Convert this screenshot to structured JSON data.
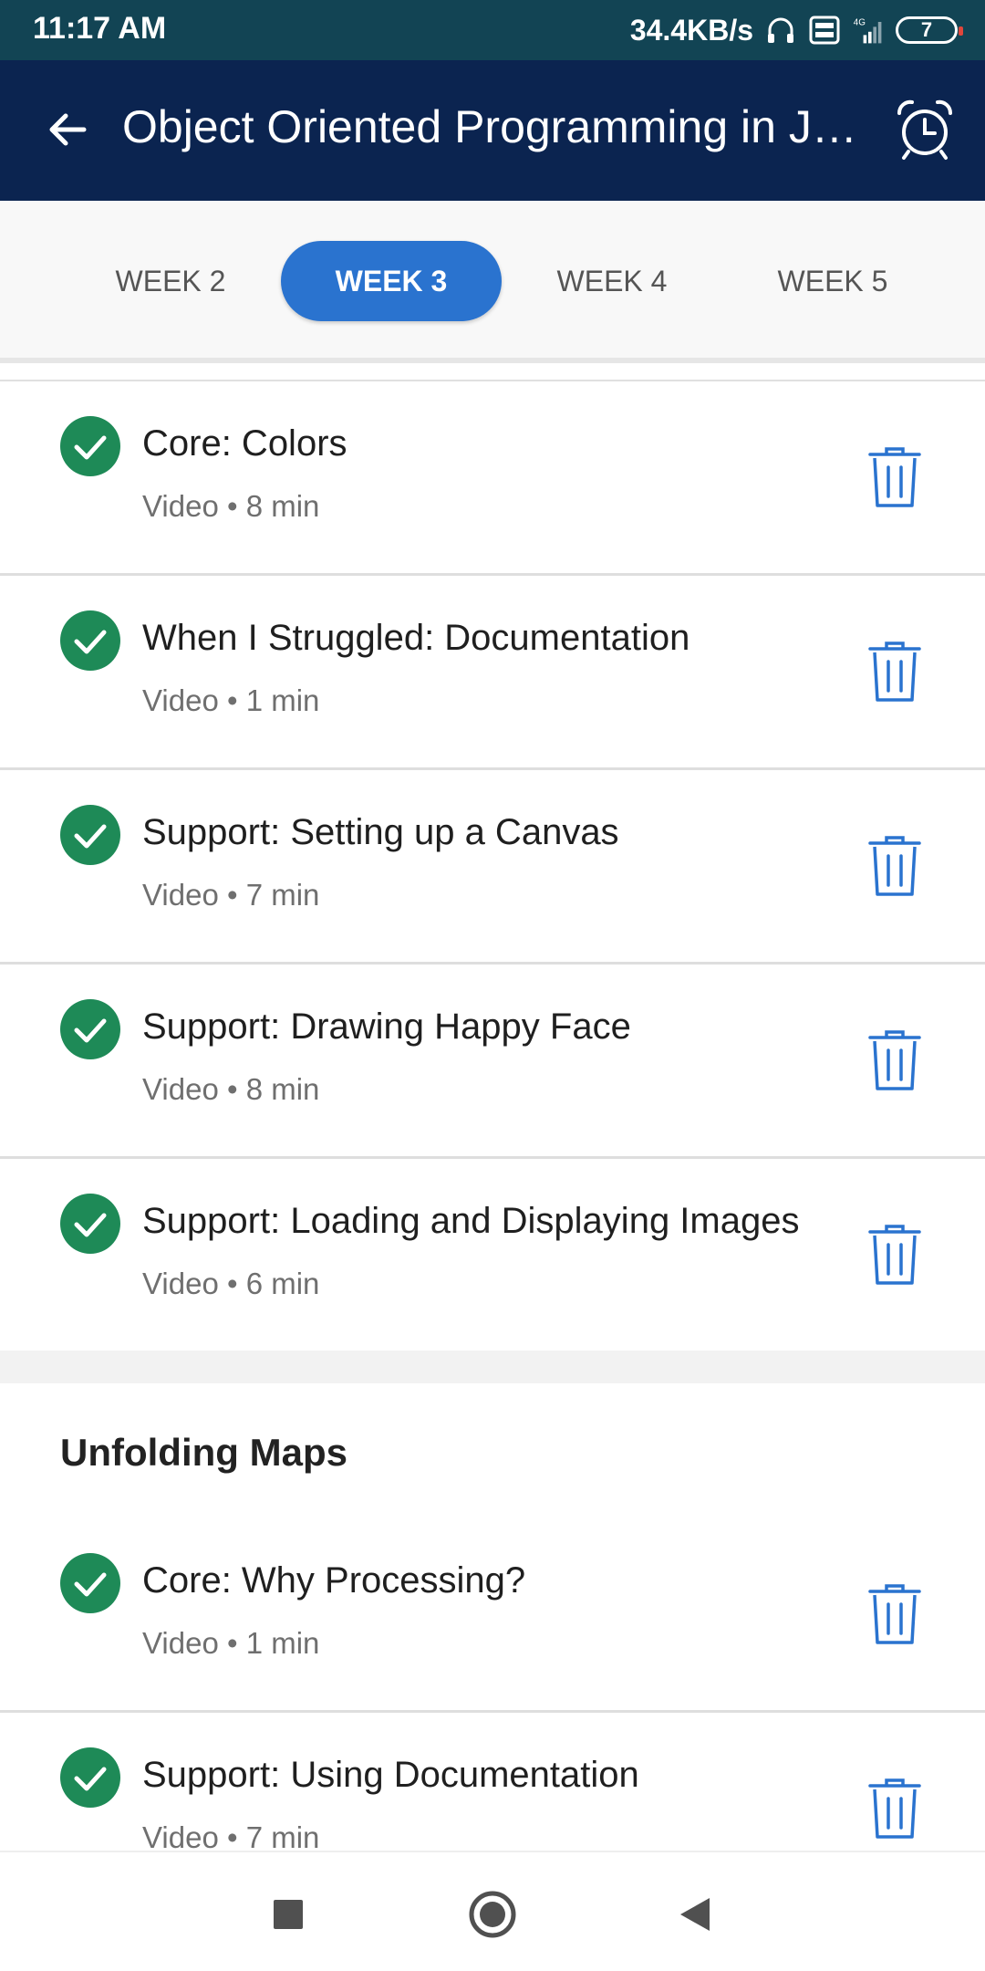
{
  "status_bar": {
    "time": "11:17 AM",
    "network_speed": "34.4KB/s",
    "volte_label": "Vo LTE",
    "network_type": "4G",
    "battery_level": "7",
    "icons": [
      "headphones-icon",
      "volte-icon",
      "signal-icon",
      "battery-icon"
    ]
  },
  "app_bar": {
    "title": "Object Oriented Programming in Ja...",
    "back_icon": "arrow-left-icon",
    "alarm_icon": "alarm-clock-icon"
  },
  "week_tabs": {
    "tabs": [
      {
        "label": "WEEK 2",
        "active": false
      },
      {
        "label": "WEEK 3",
        "active": true
      },
      {
        "label": "WEEK 4",
        "active": false
      },
      {
        "label": "WEEK 5",
        "active": false
      }
    ]
  },
  "colors": {
    "status_bar": "#124454",
    "app_bar": "#0b2450",
    "accent": "#2a73cf",
    "complete": "#1e8a57",
    "trash": "#2a73cf"
  },
  "items": [
    {
      "title": "Core: Colors",
      "meta": "Video • 8 min",
      "complete": true
    },
    {
      "title": "When I Struggled: Documentation",
      "meta": "Video • 1 min",
      "complete": true
    },
    {
      "title": "Support: Setting up a Canvas",
      "meta": "Video • 7 min",
      "complete": true
    },
    {
      "title": "Support: Drawing Happy Face",
      "meta": "Video • 8 min",
      "complete": true
    },
    {
      "title": "Support: Loading and Displaying Images",
      "meta": "Video • 6 min",
      "complete": true
    }
  ],
  "section": {
    "title": "Unfolding Maps",
    "items": [
      {
        "title": "Core: Why Processing?",
        "meta": "Video • 1 min",
        "complete": true
      },
      {
        "title": "Support: Using Documentation",
        "meta": "Video • 7 min",
        "complete": true
      }
    ]
  },
  "nav_bar": {
    "icons": [
      "recents-square-icon",
      "home-circle-icon",
      "back-triangle-icon"
    ]
  }
}
